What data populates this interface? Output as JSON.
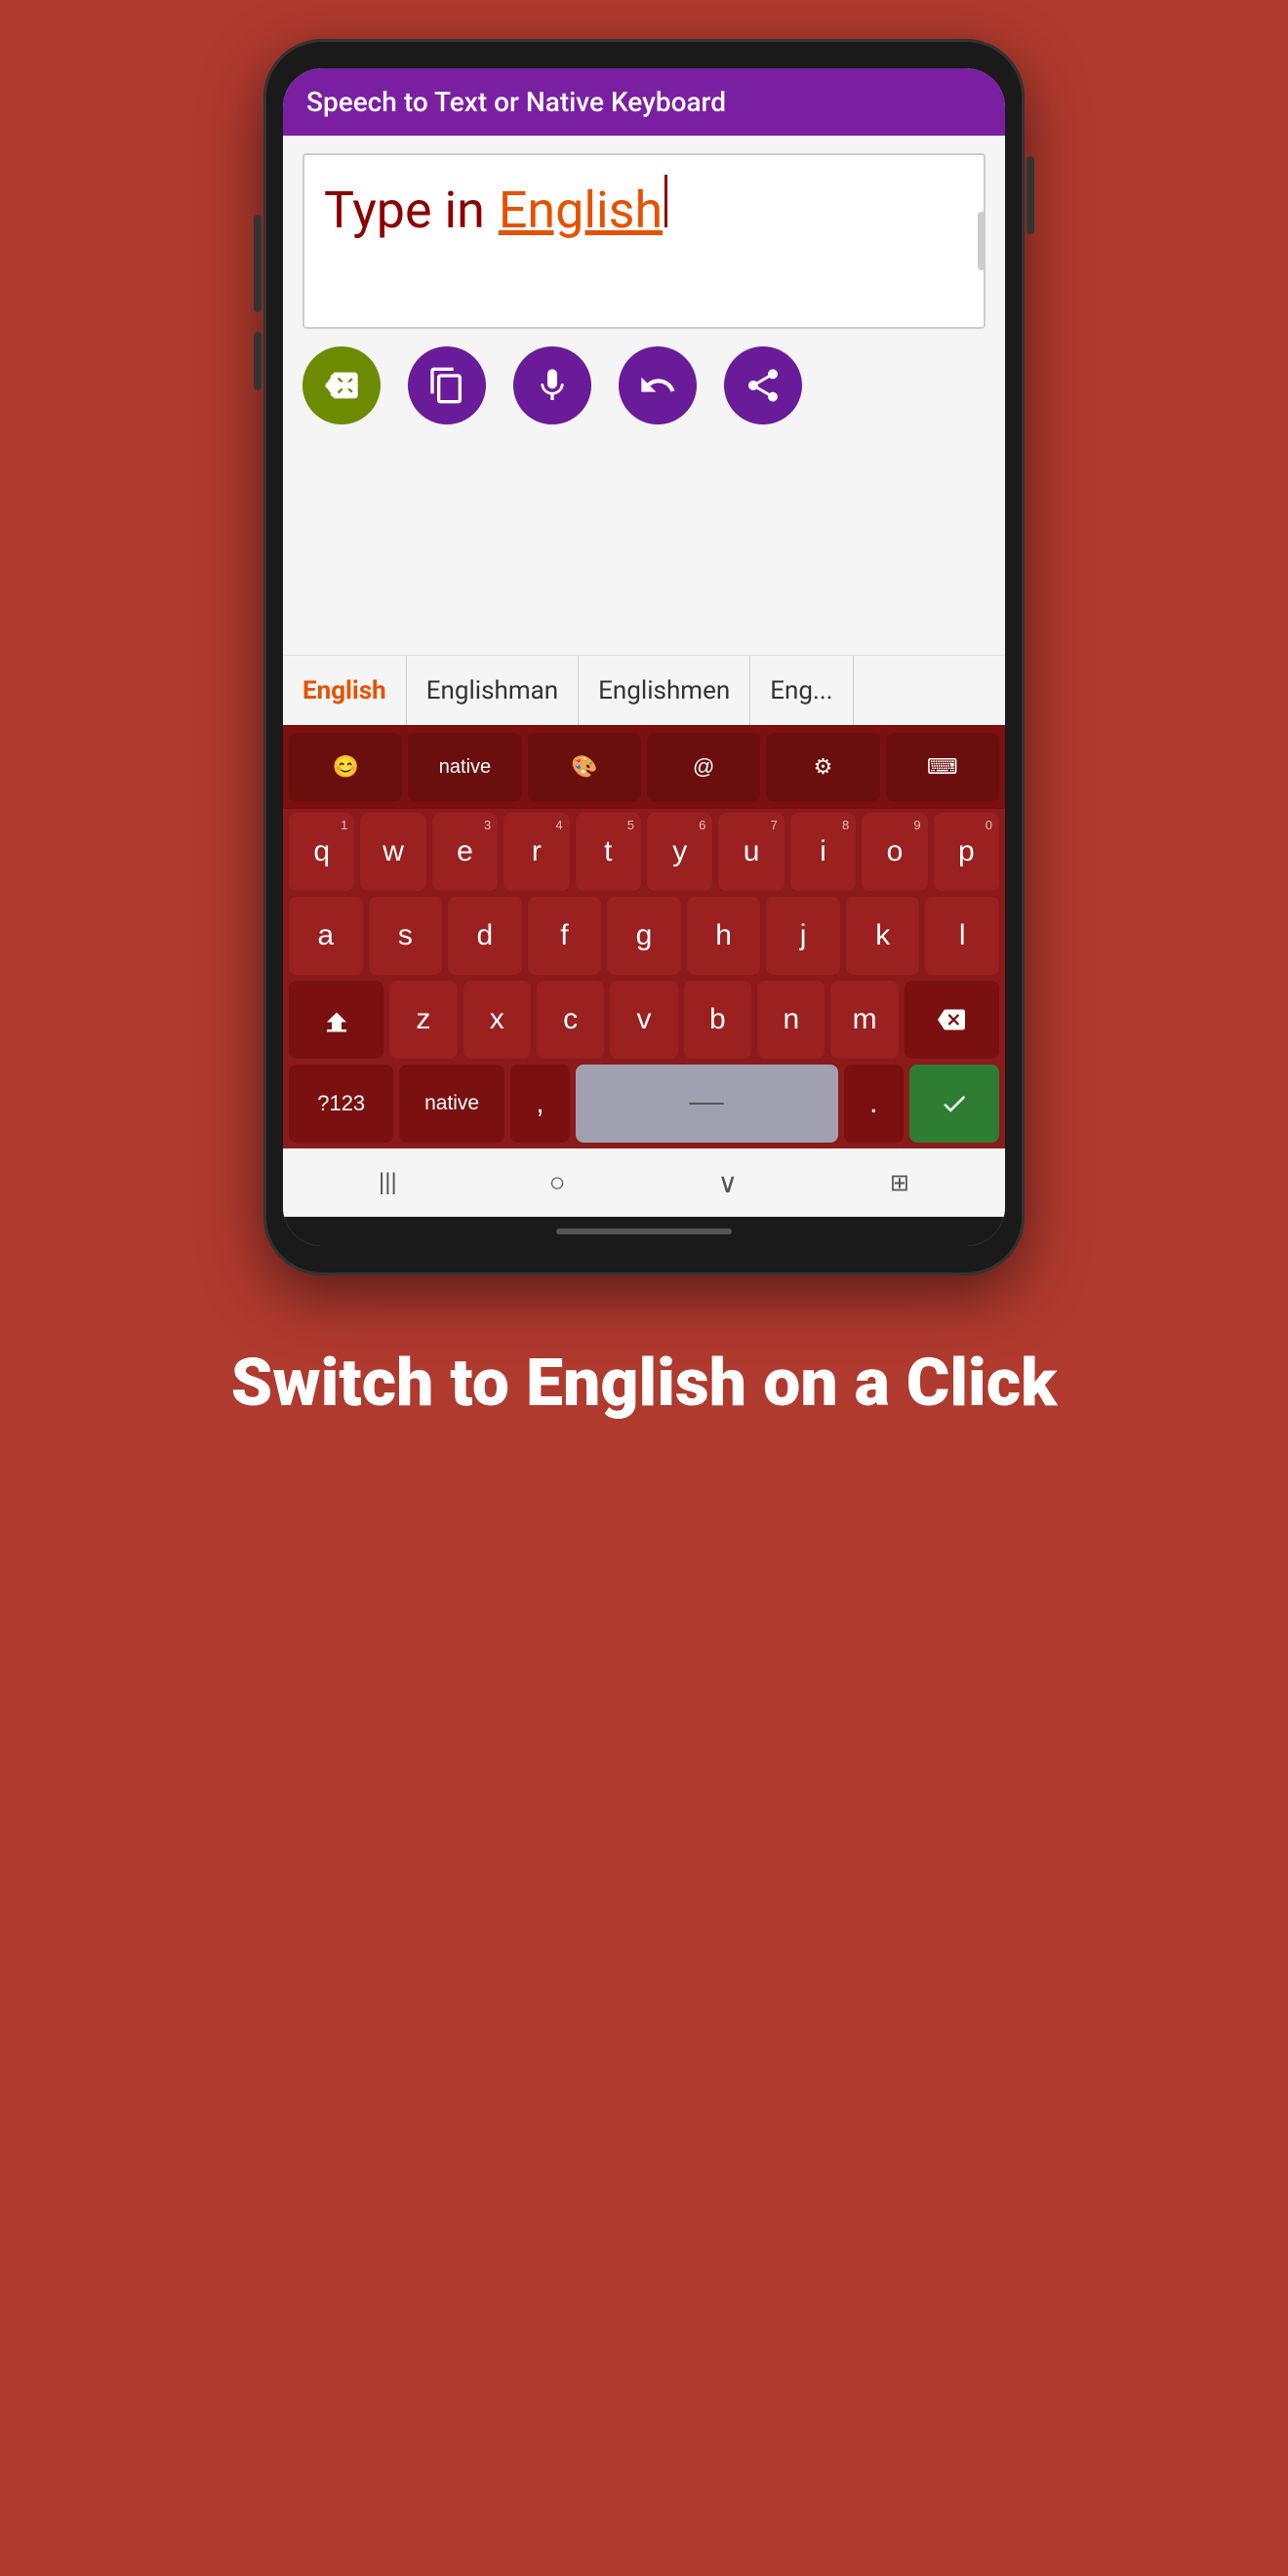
{
  "app": {
    "title": "Speech to Text or Native Keyboard"
  },
  "text_input": {
    "text": "Type in ",
    "highlight": "English",
    "placeholder": "Type in English"
  },
  "action_buttons": [
    {
      "id": "delete",
      "label": "delete"
    },
    {
      "id": "copy",
      "label": "copy"
    },
    {
      "id": "mic",
      "label": "microphone"
    },
    {
      "id": "undo",
      "label": "undo"
    },
    {
      "id": "share",
      "label": "share"
    }
  ],
  "suggestions": [
    {
      "text": "English",
      "active": true
    },
    {
      "text": "Englishman",
      "active": false
    },
    {
      "text": "Englishmen",
      "active": false
    },
    {
      "text": "Eng...",
      "active": false
    }
  ],
  "keyboard": {
    "top_icons": [
      {
        "id": "emoji",
        "symbol": "😊"
      },
      {
        "id": "native",
        "label": "native"
      },
      {
        "id": "theme",
        "symbol": "🎨"
      },
      {
        "id": "at",
        "symbol": "@"
      },
      {
        "id": "settings",
        "symbol": "⚙"
      },
      {
        "id": "keyboard",
        "symbol": "⌨"
      }
    ],
    "rows": [
      {
        "keys": [
          {
            "label": "q",
            "num": "1"
          },
          {
            "label": "w",
            "num": ""
          },
          {
            "label": "e",
            "num": "3"
          },
          {
            "label": "r",
            "num": "4"
          },
          {
            "label": "t",
            "num": "5"
          },
          {
            "label": "y",
            "num": "6"
          },
          {
            "label": "u",
            "num": "7"
          },
          {
            "label": "i",
            "num": "8"
          },
          {
            "label": "o",
            "num": "9"
          },
          {
            "label": "p",
            "num": "0"
          }
        ]
      },
      {
        "keys": [
          {
            "label": "a",
            "num": ""
          },
          {
            "label": "s",
            "num": ""
          },
          {
            "label": "d",
            "num": ""
          },
          {
            "label": "f",
            "num": ""
          },
          {
            "label": "g",
            "num": ""
          },
          {
            "label": "h",
            "num": ""
          },
          {
            "label": "j",
            "num": ""
          },
          {
            "label": "k",
            "num": ""
          },
          {
            "label": "l",
            "num": ""
          }
        ]
      },
      {
        "special": "row3",
        "keys": [
          {
            "label": "z",
            "num": ""
          },
          {
            "label": "x",
            "num": ""
          },
          {
            "label": "c",
            "num": ""
          },
          {
            "label": "v",
            "num": ""
          },
          {
            "label": "b",
            "num": ""
          },
          {
            "label": "n",
            "num": ""
          },
          {
            "label": "m",
            "num": ""
          }
        ]
      },
      {
        "special": "bottom_row"
      }
    ],
    "bottom_row": {
      "numbers": "?123",
      "native": "native",
      "comma": ",",
      "space": "",
      "period": ".",
      "enter": "✓"
    }
  },
  "nav_bar": {
    "back": "|||",
    "home": "○",
    "down": "∨",
    "grid": "⊞"
  },
  "bottom_text": "Switch to English on a Click"
}
